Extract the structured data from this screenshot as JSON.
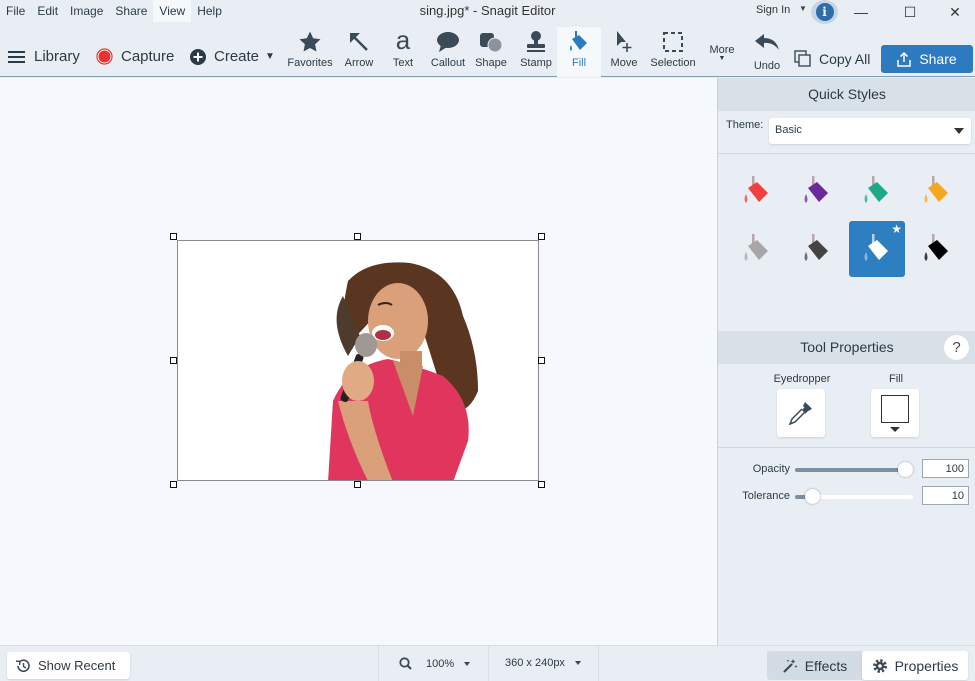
{
  "window": {
    "title": "sing.jpg* - Snagit Editor",
    "sign_in": "Sign In",
    "controls": {
      "minimize": "—",
      "maximize": "☐",
      "close": "✕"
    }
  },
  "menu": [
    {
      "label": "File",
      "active": false
    },
    {
      "label": "Edit",
      "active": false
    },
    {
      "label": "Image",
      "active": false
    },
    {
      "label": "Share",
      "active": false
    },
    {
      "label": "View",
      "active": true
    },
    {
      "label": "Help",
      "active": false
    }
  ],
  "toolbar": {
    "library": "Library",
    "capture": "Capture",
    "create": "Create",
    "tools": [
      {
        "label": "Favorites",
        "icon": "star-icon"
      },
      {
        "label": "Arrow",
        "icon": "arrow-icon"
      },
      {
        "label": "Text",
        "icon": "text-icon"
      },
      {
        "label": "Callout",
        "icon": "callout-icon"
      },
      {
        "label": "Shape",
        "icon": "shape-icon"
      },
      {
        "label": "Stamp",
        "icon": "stamp-icon"
      },
      {
        "label": "Fill",
        "icon": "fill-bucket-icon",
        "active": true
      },
      {
        "label": "Move",
        "icon": "move-icon"
      },
      {
        "label": "Selection",
        "icon": "selection-icon"
      }
    ],
    "more": "More",
    "undo": "Undo",
    "copy_all": "Copy All",
    "share": "Share"
  },
  "canvas": {
    "image_description": "Woman in pink shirt singing into a microphone, background removed"
  },
  "quick_styles": {
    "title": "Quick Styles",
    "theme_label": "Theme:",
    "theme_value": "Basic",
    "styles": [
      {
        "name": "red",
        "color": "#f2403f"
      },
      {
        "name": "purple",
        "color": "#6a2a9a"
      },
      {
        "name": "teal",
        "color": "#1fa98a"
      },
      {
        "name": "orange",
        "color": "#f3a81e"
      },
      {
        "name": "gray",
        "color": "#a7a7a7"
      },
      {
        "name": "dark-gray",
        "color": "#444444"
      },
      {
        "name": "white",
        "color": "#ffffff",
        "selected": true,
        "favorite": true
      },
      {
        "name": "black",
        "color": "#000000"
      }
    ]
  },
  "tool_properties": {
    "title": "Tool Properties",
    "help": "?",
    "eyedropper_label": "Eyedropper",
    "fill_label": "Fill",
    "fill_color": "#ffffff",
    "opacity_label": "Opacity",
    "opacity_value": "100",
    "opacity_fraction": 1.0,
    "tolerance_label": "Tolerance",
    "tolerance_value": "10",
    "tolerance_fraction": 0.1
  },
  "statusbar": {
    "show_recent": "Show Recent",
    "zoom": "100%",
    "dimensions": "360 x 240px",
    "effects": "Effects",
    "properties": "Properties"
  },
  "colors": {
    "accent": "#2e7abf",
    "capture_red": "#e8332f",
    "toolbar_bg": "#e9eef4",
    "canvas_bg": "#f5f8fc"
  }
}
